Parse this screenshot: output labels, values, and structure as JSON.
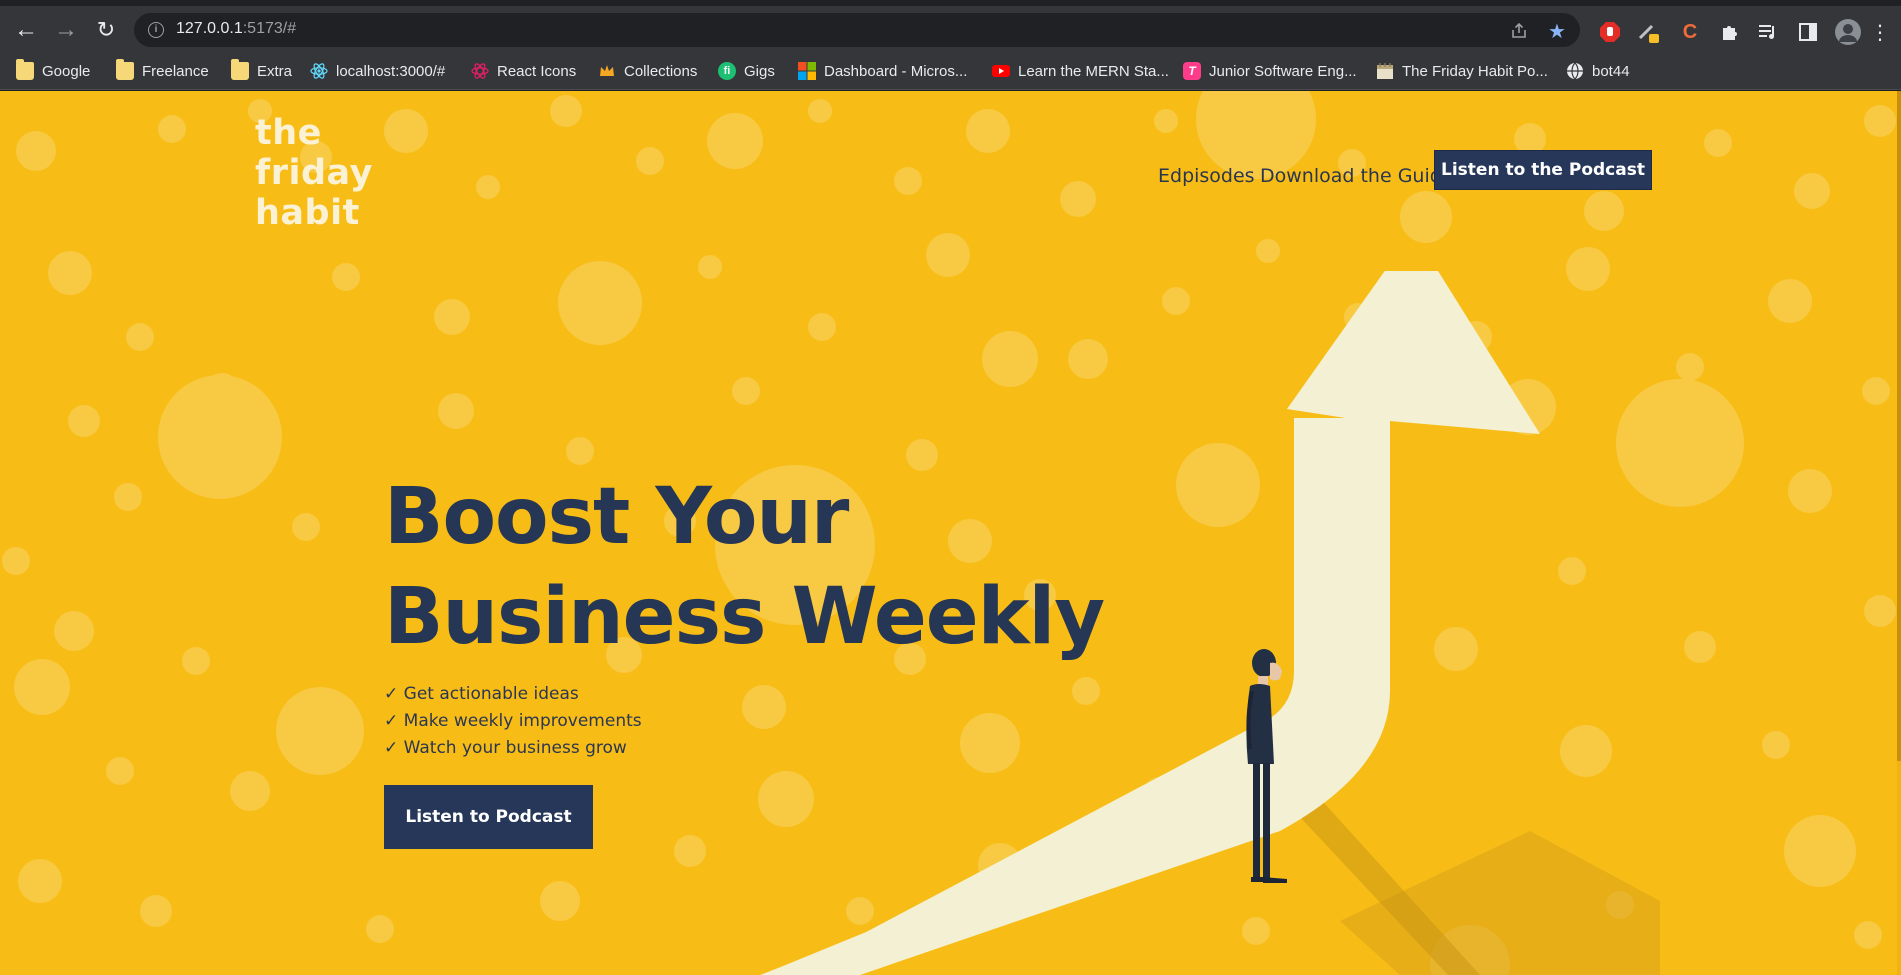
{
  "browser": {
    "url_host": "127.0.0.1",
    "url_rest": ":5173/#",
    "bookmarks": [
      {
        "label": "Google",
        "icon": "folder-icon"
      },
      {
        "label": "Freelance",
        "icon": "folder-icon"
      },
      {
        "label": "Extra",
        "icon": "folder-icon"
      },
      {
        "label": "localhost:3000/#",
        "icon": "react-icon"
      },
      {
        "label": "React Icons",
        "icon": "react-icons-icon"
      },
      {
        "label": "Collections",
        "icon": "crown-icon"
      },
      {
        "label": "Gigs",
        "icon": "fiverr-icon"
      },
      {
        "label": "Dashboard - Micros...",
        "icon": "microsoft-icon"
      },
      {
        "label": "Learn the MERN Sta...",
        "icon": "youtube-icon"
      },
      {
        "label": "Junior Software Eng...",
        "icon": "t-icon"
      },
      {
        "label": "The Friday Habit Po...",
        "icon": "calendar-icon"
      },
      {
        "label": "bot44",
        "icon": "globe-icon"
      }
    ]
  },
  "site": {
    "logo": {
      "line1": "the",
      "line2": "friday",
      "line3": "habit"
    },
    "nav": {
      "episodes": "Edpisodes",
      "guide": "Download the Guide",
      "cta": "Listen to the Podcast"
    },
    "hero": {
      "headline_line1": "Boost Your",
      "headline_line2": "Business Weekly",
      "bullets": [
        "✓ Get actionable ideas",
        "✓ Make weekly improvements",
        "✓ Watch your business grow"
      ],
      "cta": "Listen to Podcast"
    }
  },
  "colors": {
    "background": "#f7bd16",
    "navy": "#26375a",
    "cream": "#f4f0d6"
  }
}
